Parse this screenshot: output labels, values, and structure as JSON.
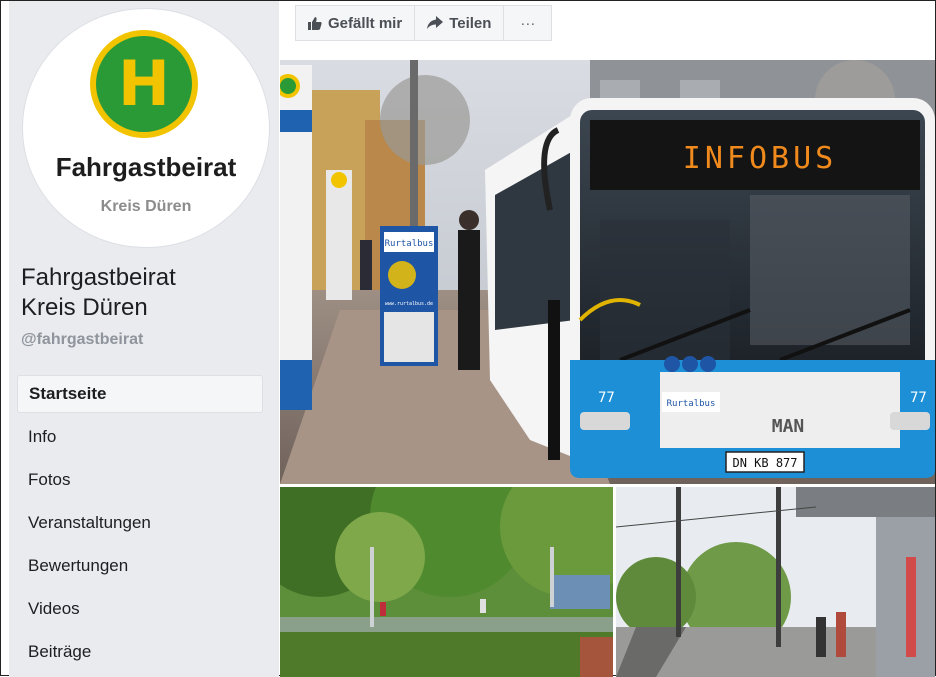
{
  "profile": {
    "logo_letter": "H",
    "logo_name": "Fahrgastbeirat",
    "logo_sub": "Kreis Düren",
    "page_name_line1": "Fahrgastbeirat",
    "page_name_line2": "Kreis Düren",
    "handle": "@fahrgastbeirat"
  },
  "nav": {
    "items": [
      {
        "label": "Startseite",
        "active": true
      },
      {
        "label": "Info"
      },
      {
        "label": "Fotos"
      },
      {
        "label": "Veranstaltungen"
      },
      {
        "label": "Bewertungen"
      },
      {
        "label": "Videos"
      },
      {
        "label": "Beiträge"
      }
    ]
  },
  "actions": {
    "like_label": "Gefällt mir",
    "share_label": "Teilen",
    "more_label": "···"
  },
  "photo": {
    "destination_sign": "INFOBUS",
    "bus_brand": "MAN",
    "fleet_number": "77",
    "license_plate": "DN KB 877",
    "operator_logo": "Rurtalbus",
    "banner_url": "www.rurtalbus.de"
  },
  "colors": {
    "sidebar_bg": "#e9ebee",
    "logo_green": "#2a9a37",
    "logo_yellow": "#f2c400",
    "bus_blue": "#1c8fd6",
    "sign_orange": "#f08a1c"
  }
}
